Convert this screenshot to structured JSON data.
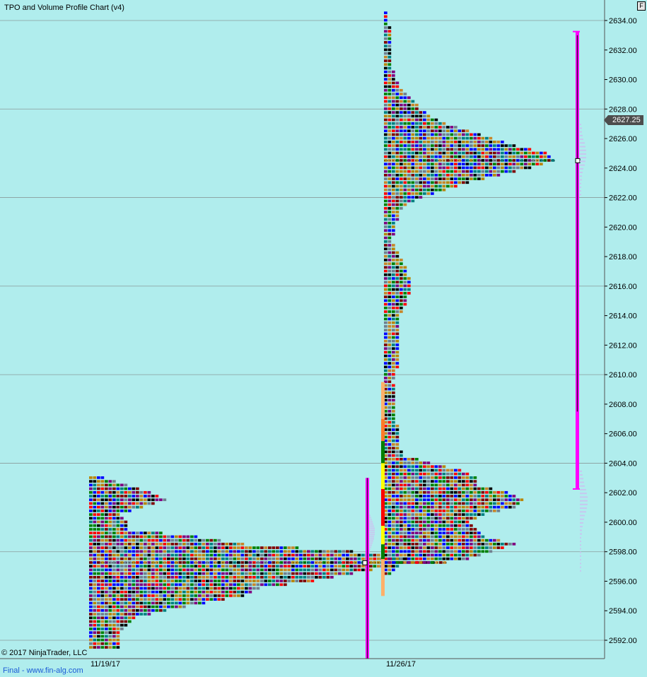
{
  "header": {
    "title": "TPO and Volume Profile Chart (v4)",
    "badge": "F"
  },
  "footer": {
    "copyright": "© 2017 NinjaTrader, LLC",
    "status": "Final - www.fin-alg.com"
  },
  "last_price": "2627.25",
  "colors": {
    "background": "#b0eded",
    "grid": "#8a9c9c",
    "range_bar": "#ff00ff",
    "tpo_palette": [
      "#800080",
      "#c8862a",
      "#ff0000",
      "#008000",
      "#0000ff",
      "#000000",
      "#708090",
      "#008080",
      "#b8860b",
      "#800000"
    ]
  },
  "chart_data": {
    "type": "tpo-profile",
    "title": "TPO and Volume Profile Chart (v4)",
    "y_axis": {
      "ticks": [
        "2634.00",
        "2632.00",
        "2630.00",
        "2628.00",
        "2626.00",
        "2624.00",
        "2622.00",
        "2620.00",
        "2618.00",
        "2616.00",
        "2614.00",
        "2612.00",
        "2610.00",
        "2608.00",
        "2606.00",
        "2604.00",
        "2602.00",
        "2600.00",
        "2598.00",
        "2596.00",
        "2594.00",
        "2592.00"
      ],
      "min": 2591.0,
      "max": 2635.0,
      "tick_size": 0.25
    },
    "x_axis": {
      "dates": [
        "11/19/17",
        "11/26/17"
      ]
    },
    "sessions": [
      {
        "date": "11/19/17",
        "low": 2591.5,
        "high": 2603.0,
        "poc": 2597.25,
        "value_area_low": 2591.0,
        "value_area_high": 2603.0,
        "width_profile": [
          [
            2591.5,
            8
          ],
          [
            2592.5,
            8
          ],
          [
            2593.5,
            12
          ],
          [
            2594.0,
            20
          ],
          [
            2594.5,
            30
          ],
          [
            2595.0,
            40
          ],
          [
            2595.5,
            44
          ],
          [
            2596.0,
            58
          ],
          [
            2596.5,
            68
          ],
          [
            2597.0,
            78
          ],
          [
            2597.25,
            92
          ],
          [
            2597.5,
            82
          ],
          [
            2598.0,
            68
          ],
          [
            2598.5,
            40
          ],
          [
            2599.0,
            28
          ],
          [
            2599.5,
            10
          ],
          [
            2600.0,
            10
          ],
          [
            2600.5,
            8
          ],
          [
            2601.0,
            14
          ],
          [
            2601.5,
            20
          ],
          [
            2602.0,
            16
          ],
          [
            2602.5,
            10
          ],
          [
            2603.0,
            4
          ]
        ]
      },
      {
        "date": "11/26/17",
        "low": 2596.5,
        "high": 2634.5,
        "poc": 2624.5,
        "value_area_low": 2602.25,
        "value_area_high": 2633.25,
        "width_profile": [
          [
            2596.5,
            2
          ],
          [
            2597.0,
            4
          ],
          [
            2597.5,
            22
          ],
          [
            2598.0,
            28
          ],
          [
            2598.5,
            34
          ],
          [
            2599.0,
            26
          ],
          [
            2599.5,
            24
          ],
          [
            2600.0,
            22
          ],
          [
            2600.5,
            26
          ],
          [
            2601.0,
            34
          ],
          [
            2601.5,
            36
          ],
          [
            2602.0,
            32
          ],
          [
            2602.5,
            24
          ],
          [
            2603.0,
            24
          ],
          [
            2603.5,
            20
          ],
          [
            2604.0,
            12
          ],
          [
            2604.5,
            5
          ],
          [
            2605.0,
            4
          ],
          [
            2606.0,
            4
          ],
          [
            2607.0,
            3
          ],
          [
            2608.0,
            3
          ],
          [
            2609.0,
            3
          ],
          [
            2609.5,
            2
          ],
          [
            2610.0,
            3
          ],
          [
            2611.0,
            4
          ],
          [
            2612.0,
            4
          ],
          [
            2613.0,
            4
          ],
          [
            2614.0,
            4
          ],
          [
            2615.0,
            6
          ],
          [
            2616.0,
            7
          ],
          [
            2617.0,
            6
          ],
          [
            2618.0,
            4
          ],
          [
            2619.0,
            2
          ],
          [
            2620.0,
            3
          ],
          [
            2621.0,
            4
          ],
          [
            2621.5,
            6
          ],
          [
            2622.0,
            10
          ],
          [
            2622.5,
            16
          ],
          [
            2623.0,
            22
          ],
          [
            2623.5,
            30
          ],
          [
            2624.0,
            38
          ],
          [
            2624.5,
            44
          ],
          [
            2625.0,
            42
          ],
          [
            2625.5,
            34
          ],
          [
            2626.0,
            28
          ],
          [
            2626.5,
            22
          ],
          [
            2627.0,
            16
          ],
          [
            2627.5,
            12
          ],
          [
            2628.0,
            9
          ],
          [
            2628.5,
            8
          ],
          [
            2629.0,
            6
          ],
          [
            2629.5,
            4
          ],
          [
            2630.0,
            3
          ],
          [
            2631.0,
            2
          ],
          [
            2632.0,
            2
          ],
          [
            2633.0,
            2
          ],
          [
            2634.0,
            1
          ],
          [
            2634.5,
            1
          ]
        ]
      }
    ]
  }
}
